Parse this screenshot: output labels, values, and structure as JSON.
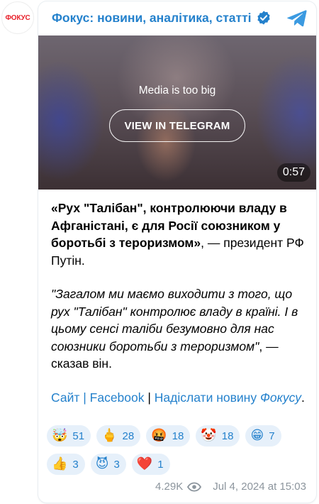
{
  "avatar": {
    "text": "ФОКУС"
  },
  "channel": {
    "title": "Фокус: новини, аналітика, статті"
  },
  "media": {
    "note": "Media is too big",
    "button_label": "VIEW IN TELEGRAM",
    "duration": "0:57"
  },
  "post": {
    "headline_bold": "«Рух \"Талібан\", контролюючи владу в Афганістані, є для Росії союзником у боротьбі з тероризмом»",
    "headline_rest": ", — президент РФ Путін.",
    "quote_italic": "\"Загалом ми маємо виходити з того, що рух \"Талібан\" контролює владу в країні. І в цьому сенсі таліби безумовно для нас союзники боротьби з тероризмом\"",
    "quote_rest": ", — сказав він.",
    "links": {
      "site": "Сайт",
      "sep1": " | ",
      "facebook": "Facebook",
      "sep2": " | ",
      "send_news": "Надіслати новину",
      "focus": "Фокусу",
      "tail": "."
    }
  },
  "reactions": [
    {
      "emoji": "🤯",
      "count": "51",
      "icon": "exploding-head-icon"
    },
    {
      "emoji": "🖕",
      "count": "28",
      "icon": "middle-finger-icon"
    },
    {
      "emoji": "🤬",
      "count": "18",
      "icon": "cursing-face-icon"
    },
    {
      "emoji": "🤡",
      "count": "18",
      "icon": "clown-face-icon"
    },
    {
      "emoji": "😁",
      "count": "7",
      "icon": "grinning-face-icon"
    },
    {
      "emoji": "👍",
      "count": "3",
      "icon": "thumbs-up-icon"
    },
    {
      "emoji": "😈",
      "count": "3",
      "icon": "smiling-devil-icon"
    },
    {
      "emoji": "❤️",
      "count": "1",
      "icon": "red-heart-icon"
    }
  ],
  "footer": {
    "views": "4.29K",
    "date": "Jul 4, 2024 at 15:03"
  },
  "colors": {
    "link": "#2481cc",
    "reaction_bg": "#e6f0fa",
    "meta": "#8c959d",
    "brand_red": "#e8202a"
  }
}
